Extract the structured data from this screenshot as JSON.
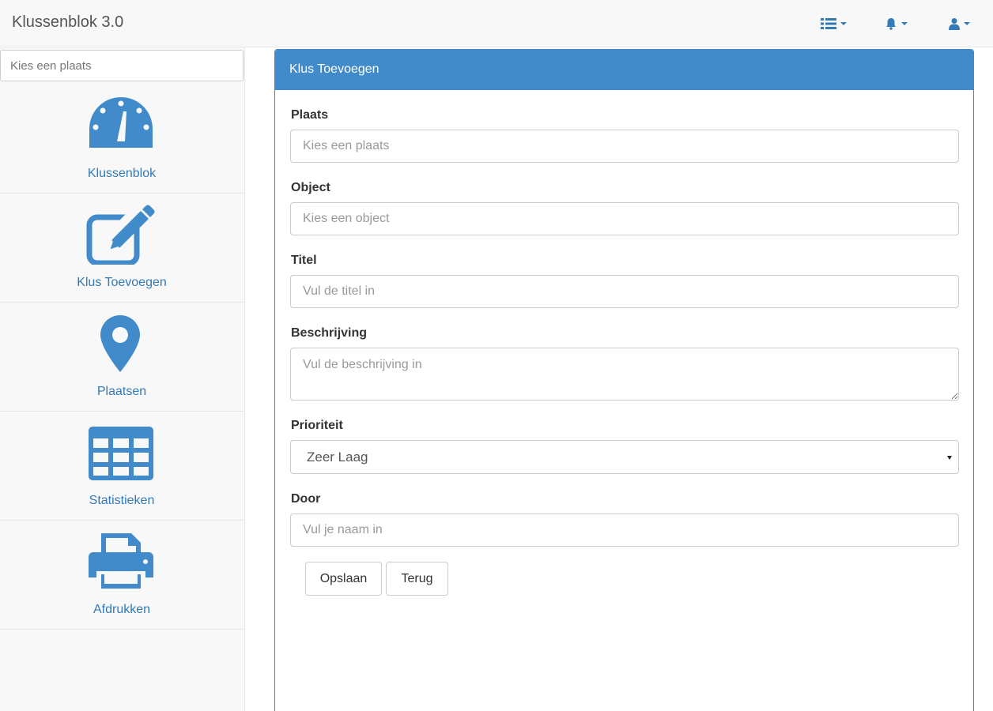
{
  "app": {
    "title": "Klussenblok 3.0"
  },
  "topnav": {
    "icons": [
      "menu-list-icon",
      "bell-icon",
      "user-icon"
    ]
  },
  "sidebar": {
    "search_placeholder": "Kies een plaats",
    "items": [
      {
        "label": "Klussenblok",
        "icon": "dashboard-icon"
      },
      {
        "label": "Klus Toevoegen",
        "icon": "edit-icon"
      },
      {
        "label": "Plaatsen",
        "icon": "map-marker-icon"
      },
      {
        "label": "Statistieken",
        "icon": "table-icon"
      },
      {
        "label": "Afdrukken",
        "icon": "printer-icon"
      }
    ]
  },
  "form": {
    "heading": "Klus Toevoegen",
    "fields": {
      "plaats": {
        "label": "Plaats",
        "placeholder": "Kies een plaats"
      },
      "object": {
        "label": "Object",
        "placeholder": "Kies een object"
      },
      "titel": {
        "label": "Titel",
        "placeholder": "Vul de titel in"
      },
      "beschrijving": {
        "label": "Beschrijving",
        "placeholder": "Vul de beschrijving in"
      },
      "prioriteit": {
        "label": "Prioriteit",
        "value": "Zeer Laag"
      },
      "door": {
        "label": "Door",
        "placeholder": "Vul je naam in"
      }
    },
    "buttons": {
      "save": "Opslaan",
      "back": "Terug"
    }
  },
  "colors": {
    "accent": "#428bca",
    "link": "#337ab7",
    "navbar_bg": "#f8f8f8"
  }
}
